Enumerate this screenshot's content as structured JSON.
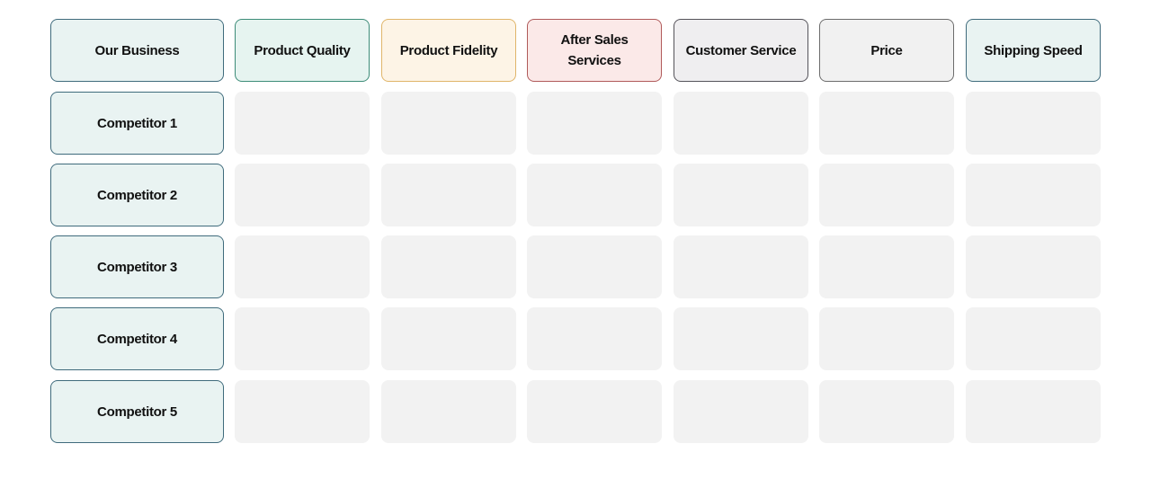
{
  "corner": "Our Business",
  "columns": [
    {
      "label": "Product Quality",
      "style": "h-quality"
    },
    {
      "label": "Product Fidelity",
      "style": "h-fidelity"
    },
    {
      "label": "After Sales\nServices",
      "style": "h-after"
    },
    {
      "label": "Customer Service",
      "style": "h-customer"
    },
    {
      "label": "Price",
      "style": "h-price"
    },
    {
      "label": "Shipping Speed",
      "style": "h-shipping"
    }
  ],
  "rows": [
    "Competitor 1",
    "Competitor 2",
    "Competitor 3",
    "Competitor 4",
    "Competitor 5"
  ],
  "cells": [
    [
      "",
      "",
      "",
      "",
      "",
      ""
    ],
    [
      "",
      "",
      "",
      "",
      "",
      ""
    ],
    [
      "",
      "",
      "",
      "",
      "",
      ""
    ],
    [
      "",
      "",
      "",
      "",
      "",
      ""
    ],
    [
      "",
      "",
      "",
      "",
      "",
      ""
    ]
  ]
}
